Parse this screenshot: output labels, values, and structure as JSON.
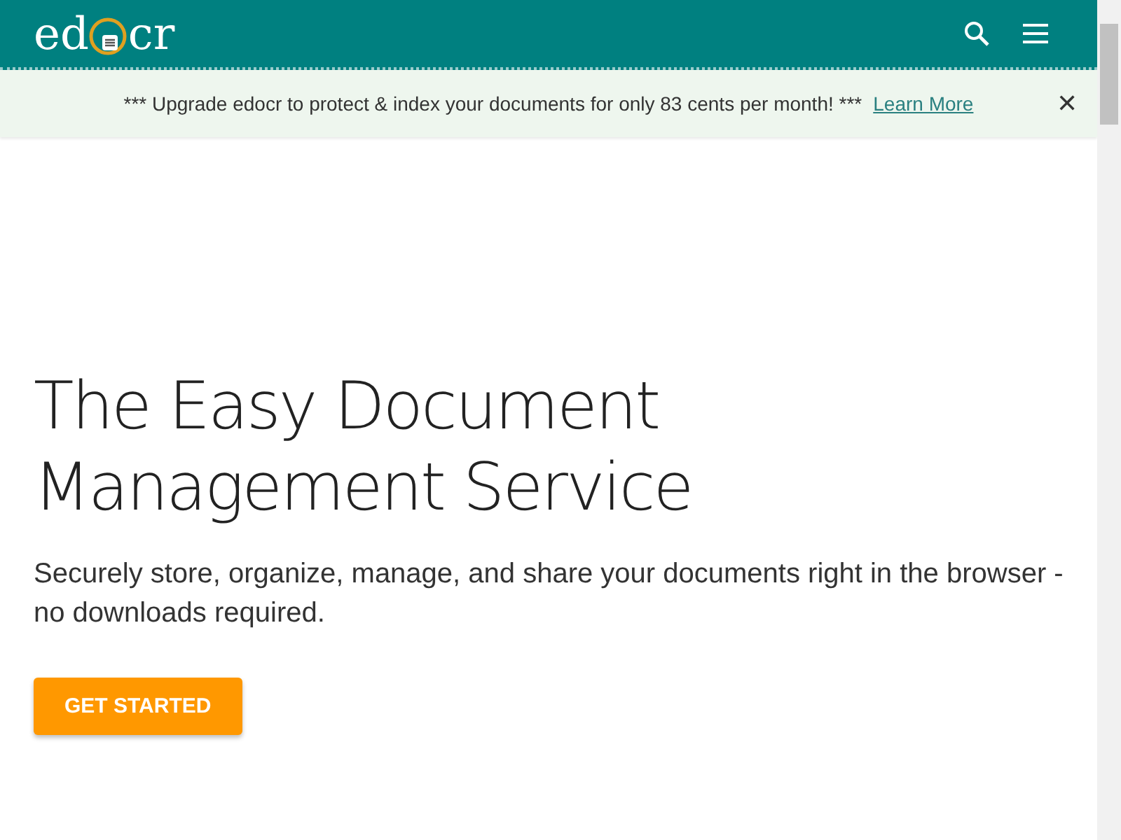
{
  "header": {
    "logo": {
      "before": "ed",
      "after": "cr"
    }
  },
  "banner": {
    "message": "*** Upgrade edocr to protect & index your documents for only 83 cents per month! ***",
    "link": "Learn More",
    "close": "✕"
  },
  "hero": {
    "title": "The Easy Document Management Service",
    "subtitle": "Securely store, organize, manage, and share your documents right in the browser - no downloads required.",
    "button": "GET STARTED"
  }
}
